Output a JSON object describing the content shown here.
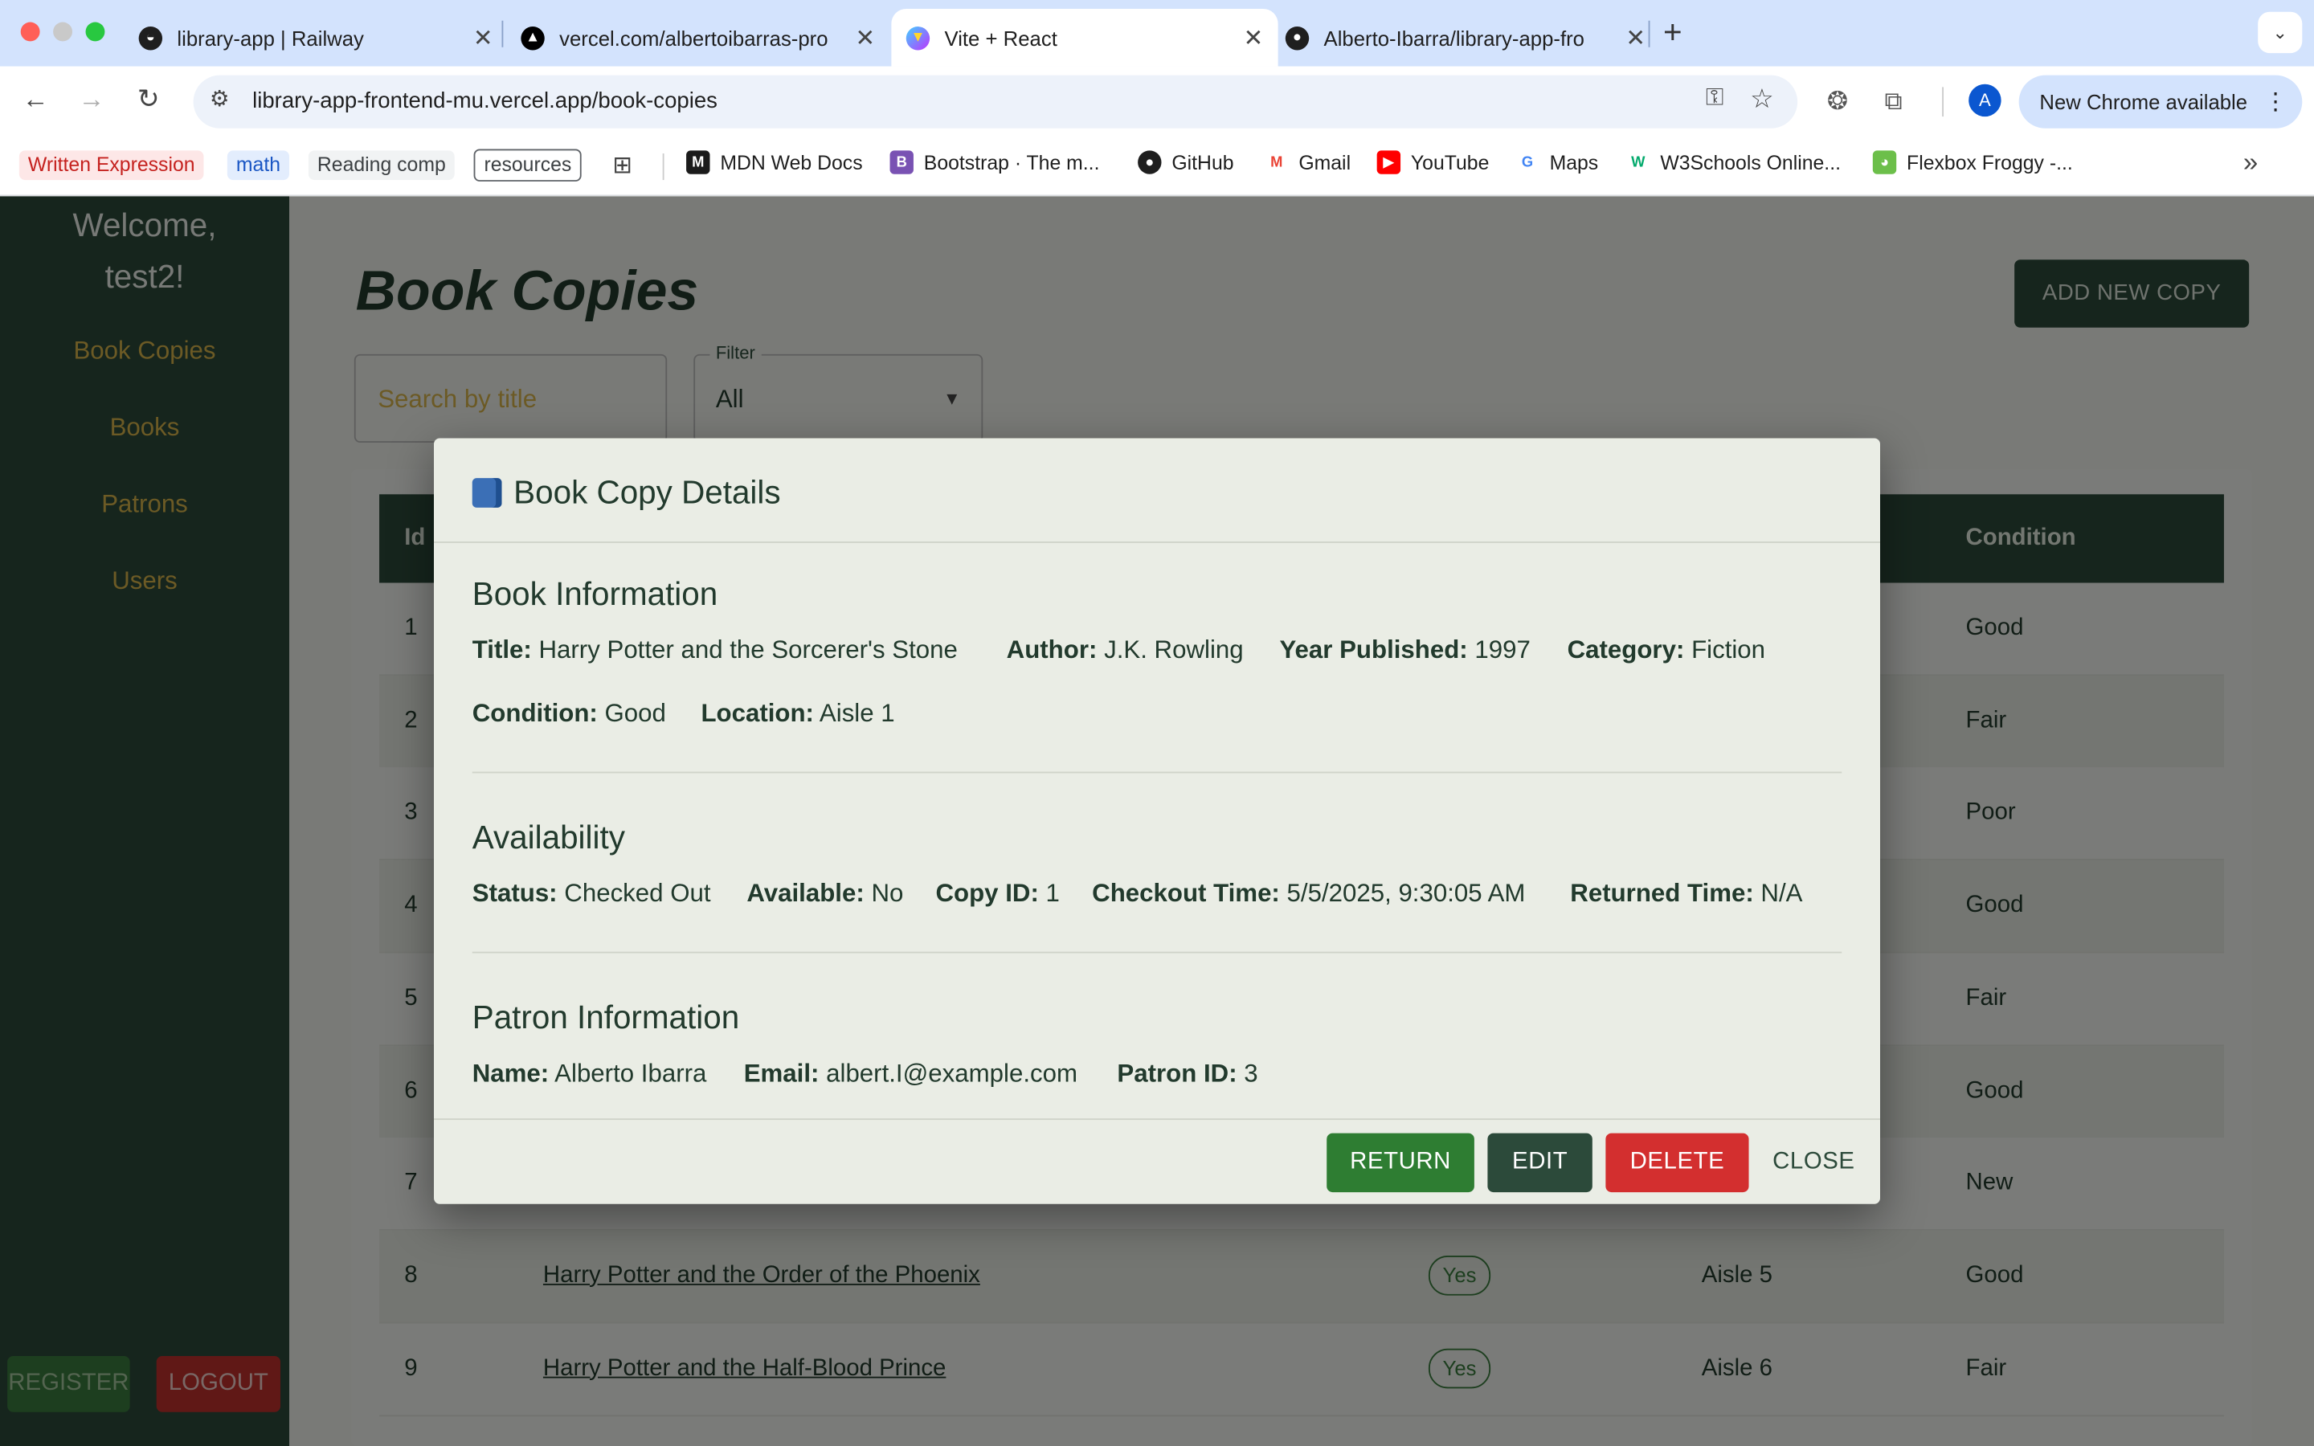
{
  "browser": {
    "tabs": [
      {
        "title": "library-app | Railway",
        "icon": "railway-icon"
      },
      {
        "title": "vercel.com/albertoibarras-pro",
        "icon": "vercel-icon"
      },
      {
        "title": "Vite + React",
        "icon": "vite-icon"
      },
      {
        "title": "Alberto-Ibarra/library-app-fro",
        "icon": "github-icon"
      }
    ],
    "new_tab": "+",
    "url": "library-app-frontend-mu.vercel.app/book-copies",
    "avatar_letter": "A",
    "update_label": "New Chrome available",
    "bookmarks": {
      "chips": [
        "Written Expression",
        "math",
        "Reading comp",
        "resources"
      ],
      "items": [
        "MDN Web Docs",
        "Bootstrap · The m...",
        "GitHub",
        "Gmail",
        "YouTube",
        "Maps",
        "W3Schools Online...",
        "Flexbox Froggy -..."
      ],
      "more": "»"
    }
  },
  "sidebar": {
    "welcome_line1": "Welcome,",
    "welcome_line2": "test2!",
    "nav": [
      "Book Copies",
      "Books",
      "Patrons",
      "Users"
    ],
    "register": "REGISTER",
    "logout": "LOGOUT"
  },
  "main": {
    "title": "Book Copies",
    "add_button": "ADD NEW COPY",
    "search_placeholder": "Search by title",
    "filter_label": "Filter",
    "filter_value": "All",
    "table": {
      "headers": {
        "id": "Id",
        "condition": "Condition"
      },
      "rows": [
        {
          "id": "1",
          "title": "",
          "available": "",
          "location": "",
          "condition": "Good"
        },
        {
          "id": "2",
          "title": "",
          "available": "",
          "location": "",
          "condition": "Fair"
        },
        {
          "id": "3",
          "title": "",
          "available": "",
          "location": "",
          "condition": "Poor"
        },
        {
          "id": "4",
          "title": "",
          "available": "",
          "location": "",
          "condition": "Good"
        },
        {
          "id": "5",
          "title": "",
          "available": "",
          "location": "",
          "condition": "Fair"
        },
        {
          "id": "6",
          "title": "",
          "available": "",
          "location": "",
          "condition": "Good"
        },
        {
          "id": "7",
          "title": "",
          "available": "",
          "location": "",
          "condition": "New"
        },
        {
          "id": "8",
          "title": "Harry Potter and the Order of the Phoenix",
          "available": "Yes",
          "location": "Aisle 5",
          "condition": "Good"
        },
        {
          "id": "9",
          "title": "Harry Potter and the Half-Blood Prince",
          "available": "Yes",
          "location": "Aisle 6",
          "condition": "Fair"
        }
      ]
    }
  },
  "modal": {
    "title": "Book Copy Details",
    "book_info": {
      "heading": "Book Information",
      "title_label": "Title:",
      "title_value": "Harry Potter and the Sorcerer's Stone",
      "author_label": "Author:",
      "author_value": "J.K. Rowling",
      "year_label": "Year Published:",
      "year_value": "1997",
      "category_label": "Category:",
      "category_value": "Fiction",
      "condition_label": "Condition:",
      "condition_value": "Good",
      "location_label": "Location:",
      "location_value": "Aisle 1"
    },
    "availability": {
      "heading": "Availability",
      "status_label": "Status:",
      "status_value": "Checked Out",
      "available_label": "Available:",
      "available_value": "No",
      "copyid_label": "Copy ID:",
      "copyid_value": "1",
      "checkout_label": "Checkout Time:",
      "checkout_value": "5/5/2025, 9:30:05 AM",
      "returned_label": "Returned Time:",
      "returned_value": "N/A"
    },
    "patron": {
      "heading": "Patron Information",
      "name_label": "Name:",
      "name_value": "Alberto Ibarra",
      "email_label": "Email:",
      "email_value": "albert.I@example.com",
      "patronid_label": "Patron ID:",
      "patronid_value": "3"
    },
    "buttons": {
      "return": "RETURN",
      "edit": "EDIT",
      "delete": "DELETE",
      "close": "CLOSE"
    }
  },
  "colors": {
    "sidebar_bg": "#2c4a3a",
    "accent_gold": "#d8b54a",
    "return_green": "#2e7d32",
    "delete_red": "#d32f2f"
  }
}
